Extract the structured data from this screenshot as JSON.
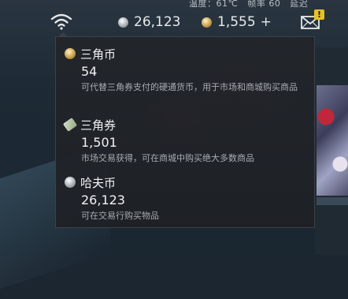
{
  "system": {
    "temperature_label": "温度：",
    "temperature_value": "61℃",
    "fps_label": "帧率",
    "fps_value": "60",
    "latency_label": "延迟"
  },
  "topbar": {
    "hafu_coin_amount": "26,123",
    "sanjiao_coin_amount": "1,555",
    "add_symbol": "+",
    "mail_alert": "!"
  },
  "popover": {
    "items": [
      {
        "name": "三角币",
        "value": "54",
        "description": "可代替三角券支付的硬通货币，用于市场和商城购买商品"
      },
      {
        "name": "三角券",
        "value": "1,501",
        "description": "市场交易获得，可在商城中购买绝大多数商品"
      },
      {
        "name": "哈夫币",
        "value": "26,123",
        "description": "可在交易行购买物品"
      }
    ]
  },
  "colors": {
    "alert": "#e9c21b",
    "popover_bg": "#22252a",
    "text_primary": "#f0f2f4",
    "text_secondary": "#a7adb3"
  },
  "icons": {
    "wifi": "wifi-icon",
    "silver_coin": "hafu-coin-icon",
    "gold_coin": "sanjiao-coin-icon",
    "ticket": "sanjiao-ticket-icon",
    "mail": "mail-icon"
  }
}
